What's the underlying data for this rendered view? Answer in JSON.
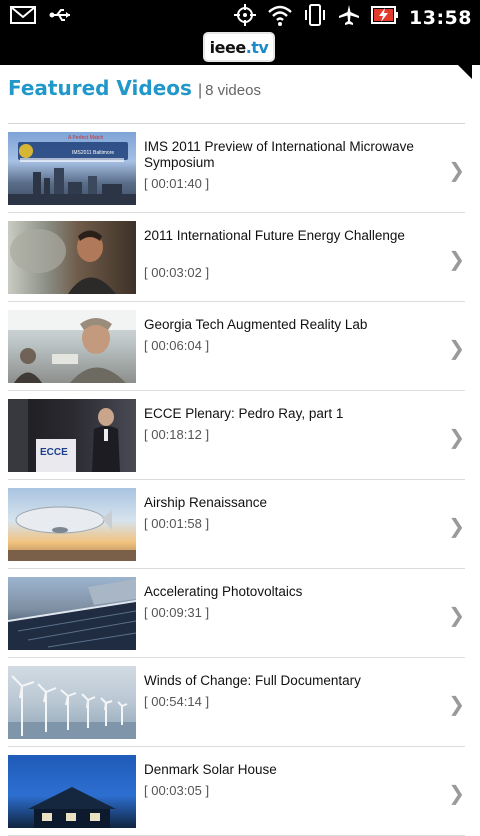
{
  "status": {
    "time": "13:58",
    "left_icons": [
      "gmail-icon",
      "usb-icon"
    ],
    "right_icons": [
      "gps-icon",
      "wifi-icon",
      "vibrate-icon",
      "airplane-icon",
      "battery-charging-icon"
    ]
  },
  "app": {
    "logo_main": "ieee",
    "logo_dot_tv": ".tv"
  },
  "header": {
    "title": "Featured Videos",
    "separator": "|",
    "count": "8 videos"
  },
  "videos": [
    {
      "title": "IMS 2011 Preview of International Microwave Symposium",
      "duration": "[ 00:01:40 ]"
    },
    {
      "title": "2011 International Future Energy Challenge",
      "duration": "[ 00:03:02 ]"
    },
    {
      "title": "Georgia Tech Augmented Reality Lab",
      "duration": "[ 00:06:04 ]"
    },
    {
      "title": "ECCE Plenary: Pedro Ray, part 1",
      "duration": "[ 00:18:12 ]"
    },
    {
      "title": "Airship Renaissance",
      "duration": "[ 00:01:58 ]"
    },
    {
      "title": "Accelerating Photovoltaics",
      "duration": "[ 00:09:31 ]"
    },
    {
      "title": "Winds of Change: Full Documentary",
      "duration": "[ 00:54:14 ]"
    },
    {
      "title": "Denmark Solar House",
      "duration": "[ 00:03:05 ]"
    }
  ],
  "thumbnails": {
    "t1_text_1": "A Perfect Match",
    "t1_text_2": "IMS2011 Baltimore",
    "t4_text": "ECCE"
  },
  "colors": {
    "accent": "#2198c9",
    "statusbar": "#000000",
    "text": "#111111",
    "muted": "#555555"
  }
}
